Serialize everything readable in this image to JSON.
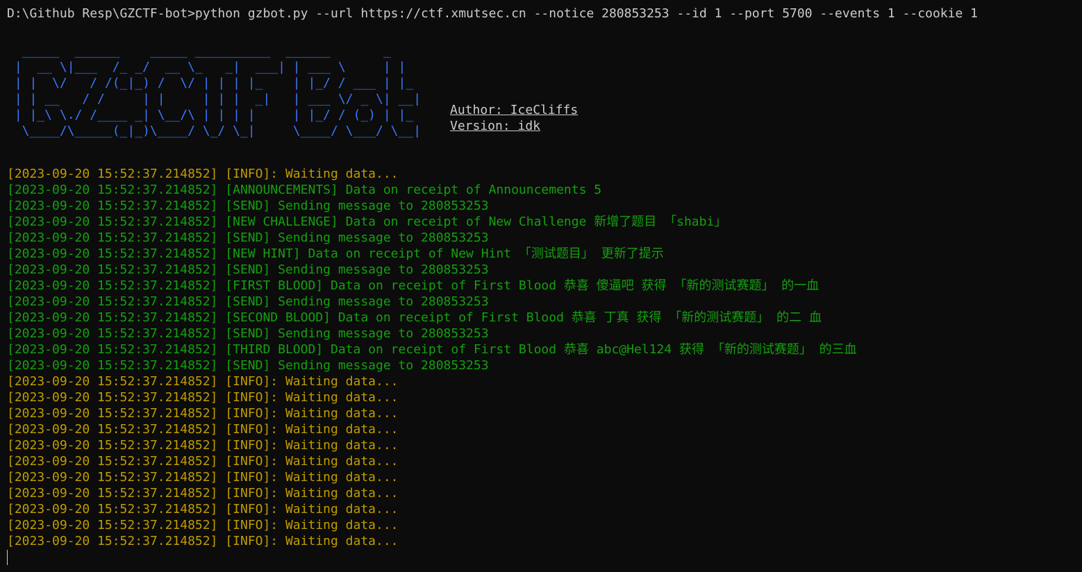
{
  "terminal": {
    "command": "D:\\Github Resp\\GZCTF-bot>python gzbot.py --url https://ctf.xmutsec.cn --notice 280853253 --id 1 --port 5700 --events 1 --cookie 1",
    "banner_lines": [
      "  _____  ______    _____ __________  ______       _ ",
      " |  __ \\|___  /_ _/  __ \\_   _|  ___| | ___ \\     | |",
      " | |  \\/   / /(_|_) /  \\/ | | | |_    | |_/ / ___ | |_",
      " | | __   / /     | |     | | |  _|   | ___ \\/ _ \\| __|",
      " | |_\\ \\./ /____ _| \\__/\\ | | | |     | |_/ / (_) | |_",
      "  \\____/\\_____(_|_)\\____/ \\_/ \\_|     \\____/ \\___/ \\__|"
    ],
    "author": "Author: IceCliffs",
    "version": "Version: idk",
    "colors": {
      "info": "#c19c00",
      "green": "#13a10e",
      "banner": "#3b78ff",
      "text": "#cccccc",
      "background": "#0c0c0c"
    },
    "log": [
      {
        "ts": "[2023-09-20 15:52:37.214852]",
        "msg": " [INFO]: Waiting data...",
        "kind": "info"
      },
      {
        "ts": "[2023-09-20 15:52:37.214852]",
        "msg": " [ANNOUNCEMENTS] Data on receipt of Announcements 5",
        "kind": "green"
      },
      {
        "ts": "[2023-09-20 15:52:37.214852]",
        "msg": " [SEND] Sending message to 280853253",
        "kind": "green"
      },
      {
        "ts": "[2023-09-20 15:52:37.214852]",
        "msg": " [NEW CHALLENGE] Data on receipt of New Challenge 新增了题目 「shabi」",
        "kind": "green"
      },
      {
        "ts": "[2023-09-20 15:52:37.214852]",
        "msg": " [SEND] Sending message to 280853253",
        "kind": "green"
      },
      {
        "ts": "[2023-09-20 15:52:37.214852]",
        "msg": " [NEW HINT] Data on receipt of New Hint 「测试题目」 更新了提示",
        "kind": "green"
      },
      {
        "ts": "[2023-09-20 15:52:37.214852]",
        "msg": " [SEND] Sending message to 280853253",
        "kind": "green"
      },
      {
        "ts": "[2023-09-20 15:52:37.214852]",
        "msg": " [FIRST BLOOD] Data on receipt of First Blood 恭喜 傻逼吧 获得 「新的测试赛题」 的一血",
        "kind": "green"
      },
      {
        "ts": "[2023-09-20 15:52:37.214852]",
        "msg": " [SEND] Sending message to 280853253",
        "kind": "green"
      },
      {
        "ts": "[2023-09-20 15:52:37.214852]",
        "msg": " [SECOND BLOOD] Data on receipt of First Blood 恭喜 丁真 获得 「新的测试赛题」 的二 血",
        "kind": "green"
      },
      {
        "ts": "[2023-09-20 15:52:37.214852]",
        "msg": " [SEND] Sending message to 280853253",
        "kind": "green"
      },
      {
        "ts": "[2023-09-20 15:52:37.214852]",
        "msg": " [THIRD BLOOD] Data on receipt of First Blood 恭喜 abc@Hel124 获得 「新的测试赛题」 的三血",
        "kind": "green"
      },
      {
        "ts": "[2023-09-20 15:52:37.214852]",
        "msg": " [SEND] Sending message to 280853253",
        "kind": "green"
      },
      {
        "ts": "[2023-09-20 15:52:37.214852]",
        "msg": " [INFO]: Waiting data...",
        "kind": "info"
      },
      {
        "ts": "[2023-09-20 15:52:37.214852]",
        "msg": " [INFO]: Waiting data...",
        "kind": "info"
      },
      {
        "ts": "[2023-09-20 15:52:37.214852]",
        "msg": " [INFO]: Waiting data...",
        "kind": "info"
      },
      {
        "ts": "[2023-09-20 15:52:37.214852]",
        "msg": " [INFO]: Waiting data...",
        "kind": "info"
      },
      {
        "ts": "[2023-09-20 15:52:37.214852]",
        "msg": " [INFO]: Waiting data...",
        "kind": "info"
      },
      {
        "ts": "[2023-09-20 15:52:37.214852]",
        "msg": " [INFO]: Waiting data...",
        "kind": "info"
      },
      {
        "ts": "[2023-09-20 15:52:37.214852]",
        "msg": " [INFO]: Waiting data...",
        "kind": "info"
      },
      {
        "ts": "[2023-09-20 15:52:37.214852]",
        "msg": " [INFO]: Waiting data...",
        "kind": "info"
      },
      {
        "ts": "[2023-09-20 15:52:37.214852]",
        "msg": " [INFO]: Waiting data...",
        "kind": "info"
      },
      {
        "ts": "[2023-09-20 15:52:37.214852]",
        "msg": " [INFO]: Waiting data...",
        "kind": "info"
      },
      {
        "ts": "[2023-09-20 15:52:37.214852]",
        "msg": " [INFO]: Waiting data...",
        "kind": "info"
      }
    ]
  }
}
